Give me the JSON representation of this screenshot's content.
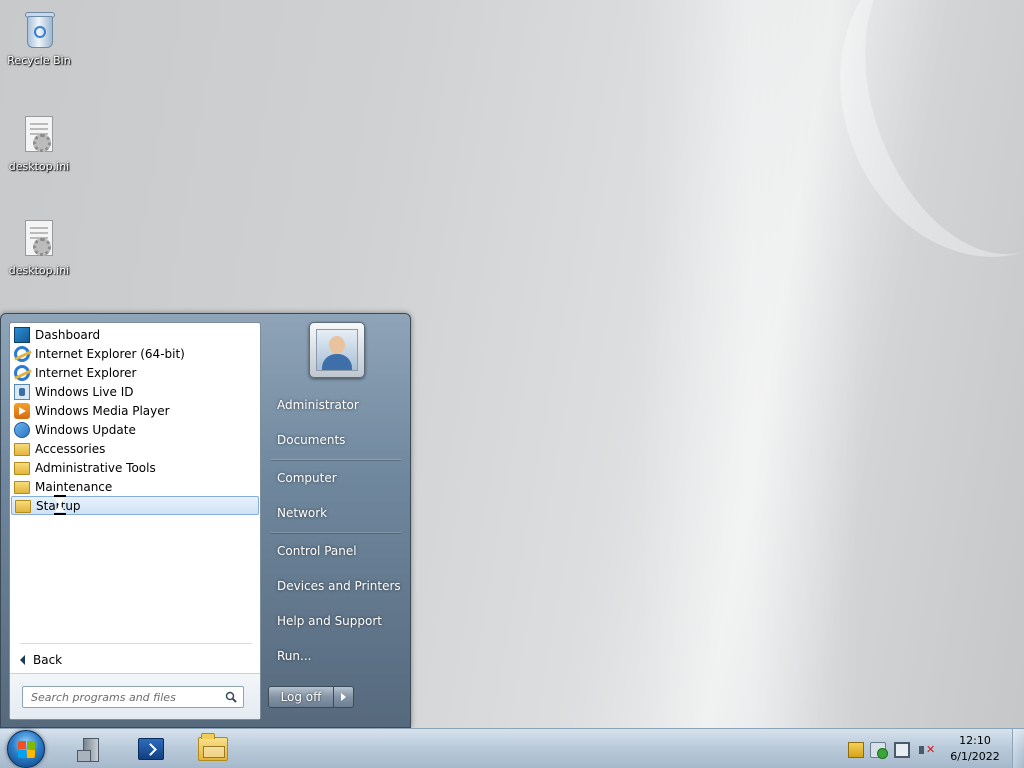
{
  "desktop": {
    "icons": [
      {
        "label": "Recycle Bin",
        "icon": "recycle-bin-icon"
      },
      {
        "label": "desktop.ini",
        "icon": "ini-file-icon"
      },
      {
        "label": "desktop.ini",
        "icon": "ini-file-icon"
      }
    ]
  },
  "start_menu": {
    "programs": [
      {
        "label": "Dashboard",
        "icon": "dashboard-icon"
      },
      {
        "label": "Internet Explorer (64-bit)",
        "icon": "internet-explorer-icon"
      },
      {
        "label": "Internet Explorer",
        "icon": "internet-explorer-icon"
      },
      {
        "label": "Windows Live ID",
        "icon": "windows-live-id-icon"
      },
      {
        "label": "Windows Media Player",
        "icon": "media-player-icon"
      },
      {
        "label": "Windows Update",
        "icon": "windows-update-icon"
      },
      {
        "label": "Accessories",
        "icon": "folder-icon"
      },
      {
        "label": "Administrative Tools",
        "icon": "folder-icon"
      },
      {
        "label": "Maintenance",
        "icon": "folder-icon"
      },
      {
        "label": "Startup",
        "icon": "folder-icon",
        "selected": true
      }
    ],
    "back_label": "Back",
    "search_placeholder": "Search programs and files",
    "right_items": {
      "administrator": "Administrator",
      "documents": "Documents",
      "computer": "Computer",
      "network": "Network",
      "control_panel": "Control Panel",
      "devices_printers": "Devices and Printers",
      "help_support": "Help and Support",
      "run": "Run..."
    },
    "logoff_label": "Log off"
  },
  "taskbar": {
    "pinned": [
      {
        "name": "server-manager",
        "icon": "server-manager-icon"
      },
      {
        "name": "powershell",
        "icon": "powershell-icon"
      },
      {
        "name": "windows-explorer",
        "icon": "folder-icon"
      }
    ],
    "tray_icons": [
      "action-center-flag-icon",
      "security-check-icon",
      "network-icon",
      "volume-muted-icon"
    ],
    "clock_time": "12:10",
    "clock_date": "6/1/2022"
  },
  "colors": {
    "accent": "#2d7fc9",
    "selection": "#cfe2f6"
  }
}
